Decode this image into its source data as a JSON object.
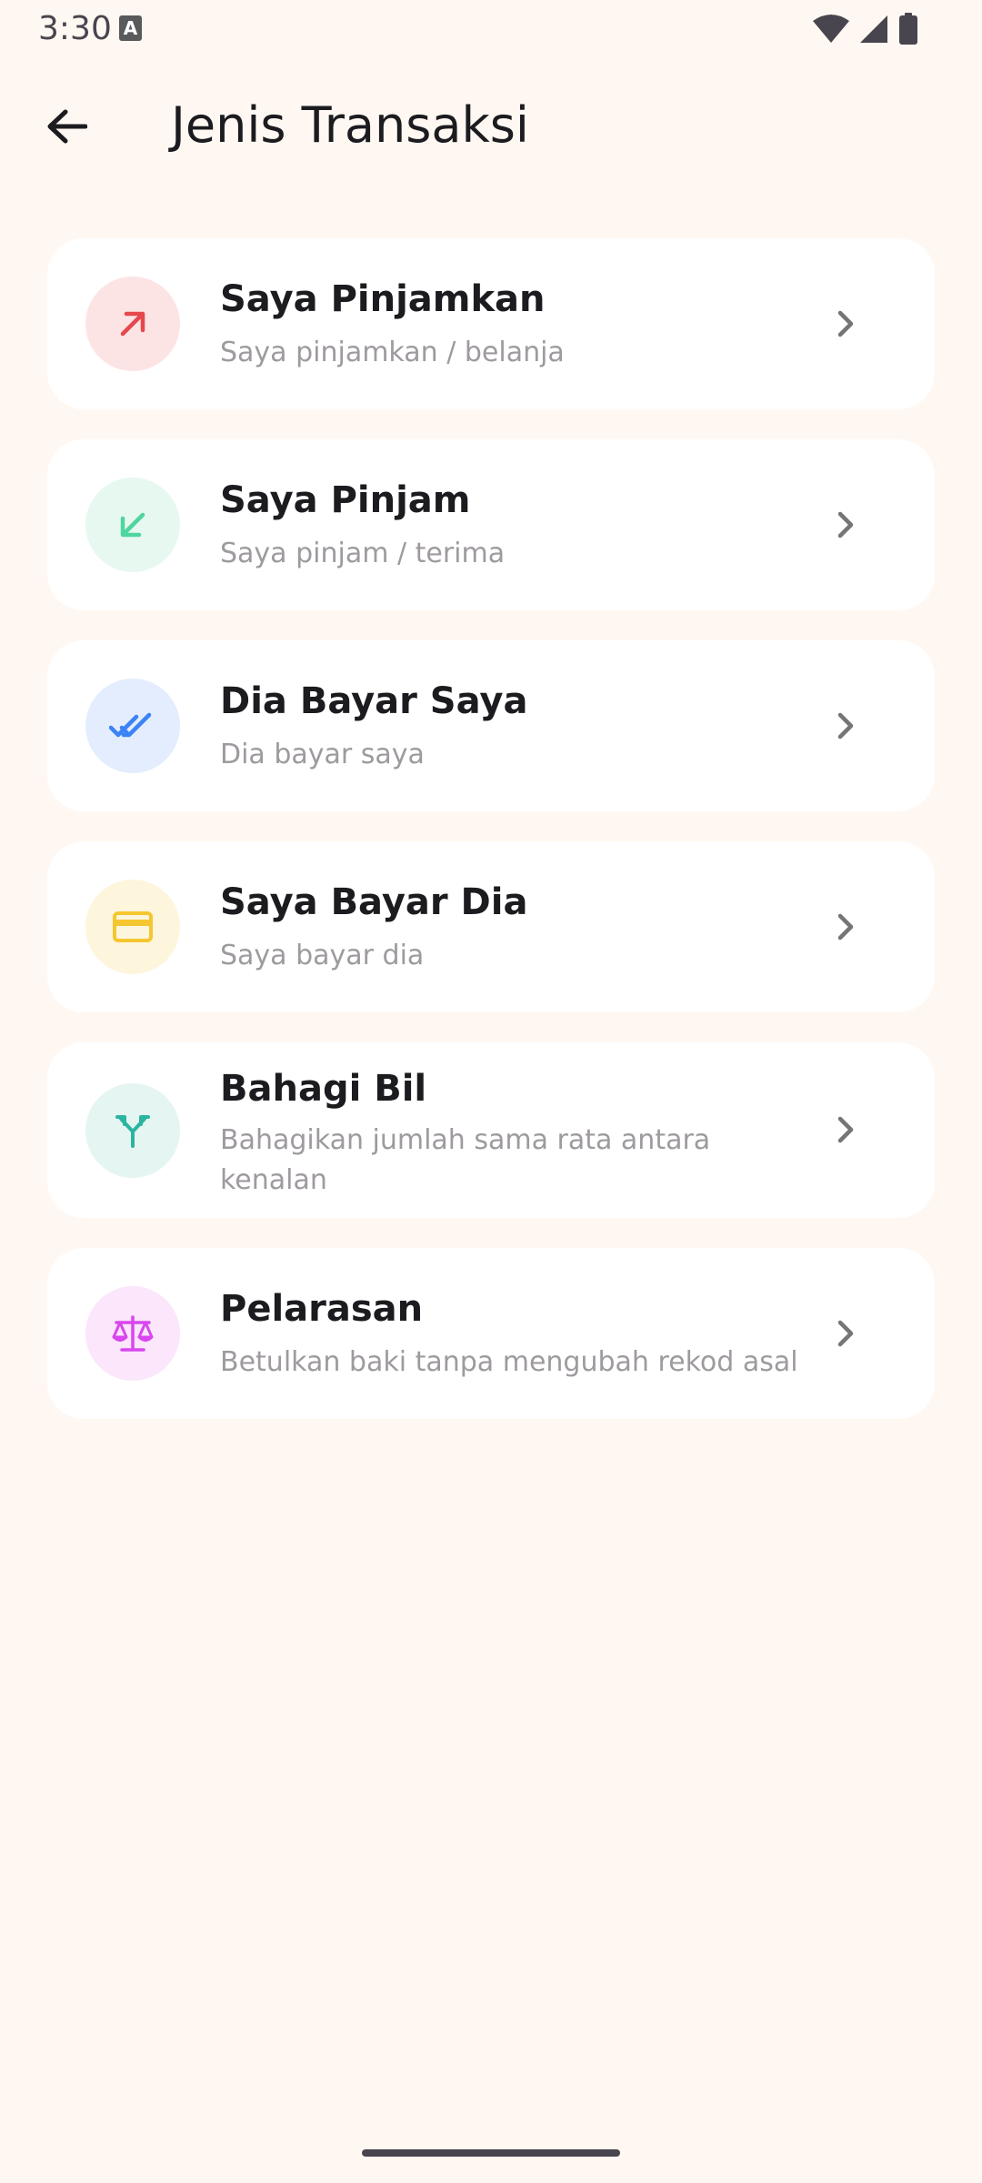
{
  "status_bar": {
    "time": "3:30",
    "notification_glyph": "A",
    "icons": [
      "wifi-icon",
      "signal-icon",
      "battery-icon"
    ]
  },
  "app_bar": {
    "title": "Jenis Transaksi",
    "back_icon": "arrow-left-icon"
  },
  "items": [
    {
      "title": "Saya Pinjamkan",
      "subtitle": "Saya pinjamkan / belanja",
      "icon": "arrow-up-right-icon",
      "icon_color": "#e5484d",
      "icon_bg": "#fde4e4"
    },
    {
      "title": "Saya Pinjam",
      "subtitle": "Saya pinjam / terima",
      "icon": "arrow-down-left-icon",
      "icon_color": "#4fd59e",
      "icon_bg": "#e7f8f0"
    },
    {
      "title": "Dia Bayar Saya",
      "subtitle": "Dia bayar saya",
      "icon": "double-check-icon",
      "icon_color": "#3b82f6",
      "icon_bg": "#e3edfd"
    },
    {
      "title": "Saya Bayar Dia",
      "subtitle": "Saya bayar dia",
      "icon": "credit-card-icon",
      "icon_color": "#f6c630",
      "icon_bg": "#fdf6dd"
    },
    {
      "title": "Bahagi Bil",
      "subtitle": "Bahagikan jumlah sama rata antara kenalan",
      "icon": "split-icon",
      "icon_color": "#2bb5a0",
      "icon_bg": "#e5f5f2"
    },
    {
      "title": "Pelarasan",
      "subtitle": "Betulkan baki tanpa mengubah rekod asal",
      "icon": "scale-icon",
      "icon_color": "#d946ef",
      "icon_bg": "#fbe6fb"
    }
  ]
}
